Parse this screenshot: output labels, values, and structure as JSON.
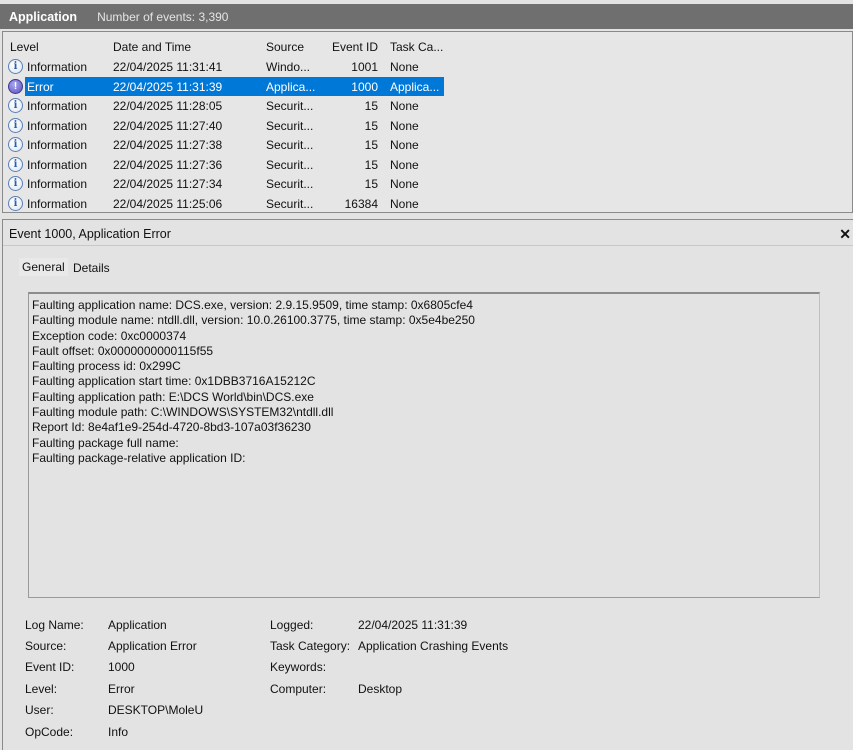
{
  "titlebar": {
    "log": "Application",
    "count": "Number of events: 3,390"
  },
  "columns": {
    "level": "Level",
    "datetime": "Date and Time",
    "source": "Source",
    "event_id": "Event ID",
    "task": "Task Ca..."
  },
  "rows": [
    {
      "level": "Information",
      "icon": "info-icon",
      "datetime": "22/04/2025 11:31:41",
      "source": "Windo...",
      "event_id": "1001",
      "task": "None"
    },
    {
      "level": "Error",
      "icon": "error-icon",
      "datetime": "22/04/2025 11:31:39",
      "source": "Applica...",
      "event_id": "1000",
      "task": "Applica...",
      "selected": true
    },
    {
      "level": "Information",
      "icon": "info-icon",
      "datetime": "22/04/2025 11:28:05",
      "source": "Securit...",
      "event_id": "15",
      "task": "None"
    },
    {
      "level": "Information",
      "icon": "info-icon",
      "datetime": "22/04/2025 11:27:40",
      "source": "Securit...",
      "event_id": "15",
      "task": "None"
    },
    {
      "level": "Information",
      "icon": "info-icon",
      "datetime": "22/04/2025 11:27:38",
      "source": "Securit...",
      "event_id": "15",
      "task": "None"
    },
    {
      "level": "Information",
      "icon": "info-icon",
      "datetime": "22/04/2025 11:27:36",
      "source": "Securit...",
      "event_id": "15",
      "task": "None"
    },
    {
      "level": "Information",
      "icon": "info-icon",
      "datetime": "22/04/2025 11:27:34",
      "source": "Securit...",
      "event_id": "15",
      "task": "None"
    },
    {
      "level": "Information",
      "icon": "info-icon",
      "datetime": "22/04/2025 11:25:06",
      "source": "Securit...",
      "event_id": "16384",
      "task": "None"
    }
  ],
  "detail": {
    "title": "Event 1000, Application Error",
    "close": "x",
    "tabs": [
      "General",
      "Details"
    ],
    "description": [
      "Faulting application name: DCS.exe, version: 2.9.15.9509, time stamp: 0x6805cfe4",
      "Faulting module name: ntdll.dll, version: 10.0.26100.3775, time stamp: 0x5e4be250",
      "Exception code: 0xc0000374",
      "Fault offset: 0x0000000000115f55",
      "Faulting process id: 0x299C",
      "Faulting application start time: 0x1DBB3716A15212C",
      "Faulting application path: E:\\DCS World\\bin\\DCS.exe",
      "Faulting module path: C:\\WINDOWS\\SYSTEM32\\ntdll.dll",
      "Report Id: 8e4af1e9-254d-4720-8bd3-107a03f36230",
      "Faulting package full name:",
      "Faulting package-relative application ID:"
    ],
    "props_left": [
      {
        "label": "Log Name:",
        "value": "Application"
      },
      {
        "label": "Source:",
        "value": "Application Error"
      },
      {
        "label": "Event ID:",
        "value": "1000"
      },
      {
        "label": "Level:",
        "value": "Error"
      },
      {
        "label": "User:",
        "value": "DESKTOP\\MoleU"
      },
      {
        "label": "OpCode:",
        "value": "Info"
      }
    ],
    "props_right": [
      {
        "label": "Logged:",
        "value": "22/04/2025 11:31:39"
      },
      {
        "label": "Task Category:",
        "value": "Application Crashing Events"
      },
      {
        "label": "Keywords:",
        "value": ""
      },
      {
        "label": "Computer:",
        "value": "Desktop"
      }
    ]
  },
  "colors": {
    "selection": "#0078d7",
    "titlebar": "#6f6f6f"
  }
}
